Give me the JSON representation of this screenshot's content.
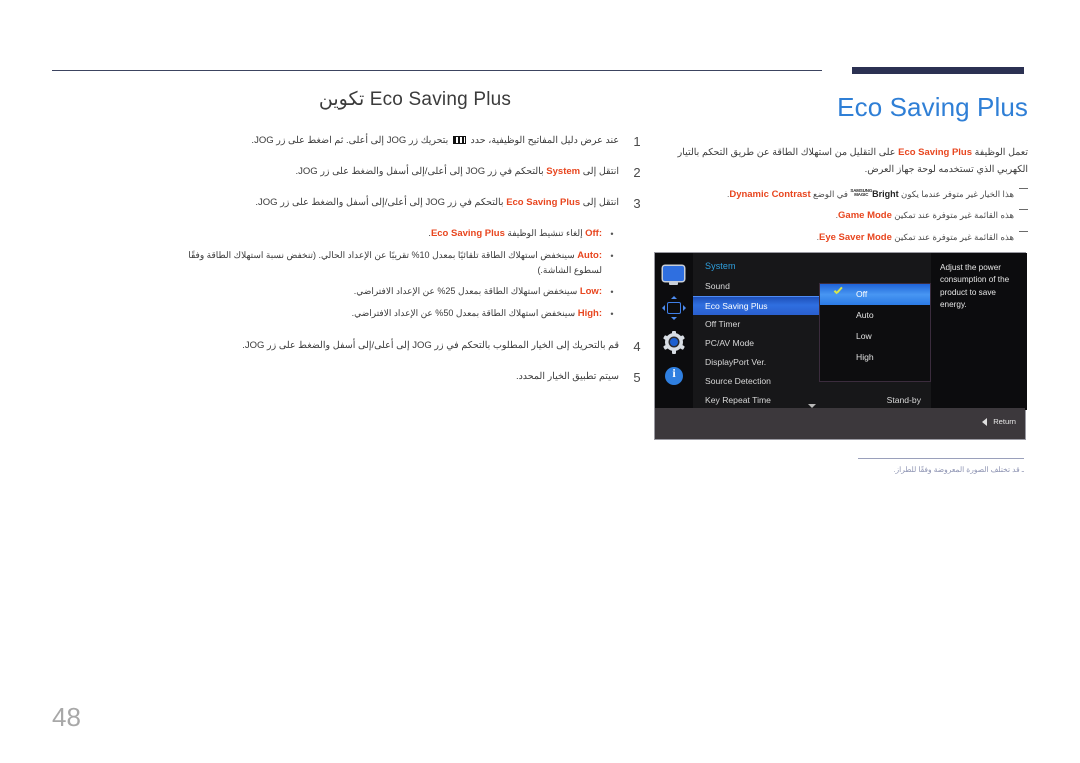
{
  "page": {
    "number": "48"
  },
  "left": {
    "title_prefix": "تكوين",
    "title_latin": "Eco Saving Plus",
    "steps": [
      {
        "num": "1",
        "pre": "عند عرض دليل المفاتيح الوظيفية، حدد",
        "icon": "jog-guide-icon",
        "post_a": "بتحريك زر",
        "jog1": "JOG",
        "post_b": "إلى أعلى. ثم اضغط على زر",
        "jog2": "JOG",
        "tail": "."
      },
      {
        "num": "2",
        "pre": "انتقل إلى",
        "keyword": "System",
        "post_a": "بالتحكم في زر",
        "jog1": "JOG",
        "post_b": "إلى أعلى/إلى أسفل والضغط على زر",
        "jog2": "JOG",
        "tail": "."
      },
      {
        "num": "3",
        "pre": "انتقل إلى",
        "keyword": "Eco Saving Plus",
        "post_a": "بالتحكم في زر",
        "jog1": "JOG",
        "post_b": "إلى أعلى/إلى أسفل والضغط على زر",
        "jog2": "JOG",
        "tail": "."
      },
      {
        "num": "4",
        "pre": "قم بالتحريك إلى الخيار المطلوب بالتحكم في زر",
        "jog1": "JOG",
        "post_b": "إلى أعلى/إلى أسفل والضغط على زر",
        "jog2": "JOG",
        "tail": "."
      },
      {
        "num": "5",
        "pre": "سيتم تطبيق الخيار المحدد."
      }
    ],
    "bullets": [
      {
        "keyword": "Off",
        "sep": ":",
        "text_pre": "إلغاء تنشيط الوظيفة",
        "keyword_tail": "Eco Saving Plus",
        "text_post": "."
      },
      {
        "keyword": "Auto",
        "sep": ":",
        "text": "سينخفض استهلاك الطاقة تلقائيًا بمعدل 10% تقريبًا عن الإعداد الحالي. (تنخفض نسبة استهلاك الطاقة وفقًا لسطوع الشاشة.)"
      },
      {
        "keyword": "Low",
        "sep": ":",
        "text": "سينخفض استهلاك الطاقة بمعدل 25% عن الإعداد الافتراضي."
      },
      {
        "keyword": "High",
        "sep": ":",
        "text": "سينخفض استهلاك الطاقة بمعدل 50% عن الإعداد الافتراضي."
      }
    ]
  },
  "right": {
    "title": "Eco Saving Plus",
    "paragraph_parts": {
      "a": "تعمل الوظيفة",
      "kw": "Eco Saving Plus",
      "b": "على التقليل من استهلاك الطاقة عن طريق التحكم بالتيار الكهربي الذي تستخدمه لوحة جهاز العرض."
    },
    "notes": [
      {
        "pre": "هذا الخيار غير متوفر عندما يكون",
        "magic_top": "SAMSUNG",
        "magic_bottom": "MAGIC",
        "magic_word": "Bright",
        "mid": "في الوضع",
        "kw": "Dynamic Contrast",
        "tail": "."
      },
      {
        "pre": "هذه القائمة غير متوفرة عند تمكين",
        "kw": "Game Mode",
        "tail": "."
      },
      {
        "pre": "هذه القائمة غير متوفرة عند تمكين",
        "kw": "Eye Saver Mode",
        "tail": "."
      }
    ],
    "figure_note": "ـ قد تختلف الصورة المعروضة وفقًا للطراز."
  },
  "osd": {
    "sidebar_icons": [
      "monitor-icon",
      "position-arrows-icon",
      "gear-icon",
      "info-icon"
    ],
    "menu_title": "System",
    "menu_items": [
      {
        "label": "Sound",
        "value": "",
        "selected": false
      },
      {
        "label": "Eco Saving Plus",
        "value": "",
        "selected": true
      },
      {
        "label": "Off Timer",
        "value": "",
        "selected": false
      },
      {
        "label": "PC/AV Mode",
        "value": "",
        "selected": false
      },
      {
        "label": "DisplayPort Ver.",
        "value": "",
        "selected": false
      },
      {
        "label": "Source Detection",
        "value": "",
        "selected": false
      },
      {
        "label": "Key Repeat Time",
        "value": "Stand-by",
        "selected": false
      }
    ],
    "submenu_options": [
      {
        "label": "Off",
        "checked": true,
        "selected": true
      },
      {
        "label": "Auto",
        "checked": false,
        "selected": false
      },
      {
        "label": "Low",
        "checked": false,
        "selected": false
      },
      {
        "label": "High",
        "checked": false,
        "selected": false
      }
    ],
    "help_text": "Adjust the power consumption of the product to save energy.",
    "return_label": "Return"
  },
  "colors": {
    "accent_blue": "#2f7fd6",
    "keyword_red": "#e8461f",
    "osd_highlight": "#2f6fe0",
    "rule_dark": "#2b3152"
  }
}
